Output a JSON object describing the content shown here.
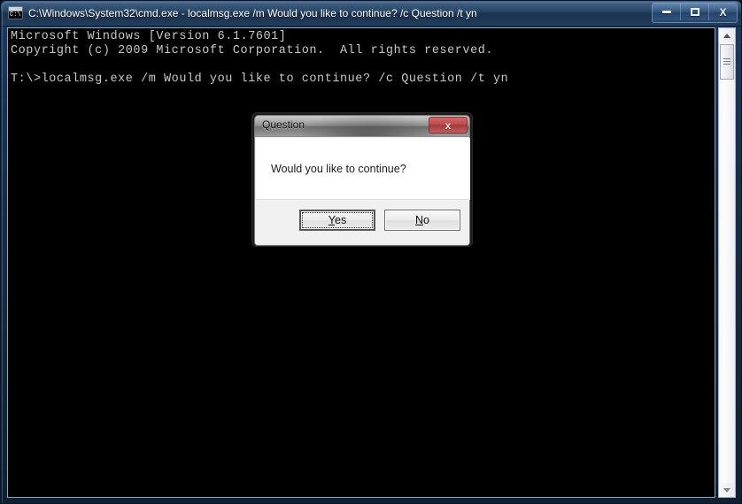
{
  "window": {
    "title": "C:\\Windows\\System32\\cmd.exe - localmsg.exe  /m Would you like to continue? /c Question /t yn",
    "icon": "cmd-console-icon",
    "icon_text": "C:\\",
    "controls": {
      "minimize_label": "Minimize",
      "maximize_label": "Maximize",
      "close_label": "X"
    }
  },
  "console": {
    "lines": [
      "Microsoft Windows [Version 6.1.7601]",
      "Copyright (c) 2009 Microsoft Corporation.  All rights reserved.",
      "",
      "T:\\>localmsg.exe /m Would you like to continue? /c Question /t yn"
    ],
    "text": "Microsoft Windows [Version 6.1.7601]\nCopyright (c) 2009 Microsoft Corporation.  All rights reserved.\n\nT:\\>localmsg.exe /m Would you like to continue? /c Question /t yn",
    "background_color": "#000000",
    "text_color": "#c8c8c8"
  },
  "scrollbar": {
    "up_arrow": "scroll-up-arrow",
    "down_arrow": "scroll-down-arrow",
    "thumb": "scroll-thumb"
  },
  "dialog": {
    "title": "Question",
    "message": "Would you like to continue?",
    "close_label": "x",
    "buttons": [
      {
        "label": "Yes",
        "accel": "Y",
        "rest": "es",
        "default": true,
        "focused": true
      },
      {
        "label": "No",
        "accel": "N",
        "rest": "o",
        "default": false,
        "focused": false
      }
    ]
  },
  "colors": {
    "title_bar": "#22405f",
    "console_bg": "#000000",
    "console_fg": "#c8c8c8",
    "dialog_face": "#f0f0f0",
    "dialog_close_red": "#bb4b4b",
    "frame_blue": "#17314f"
  }
}
